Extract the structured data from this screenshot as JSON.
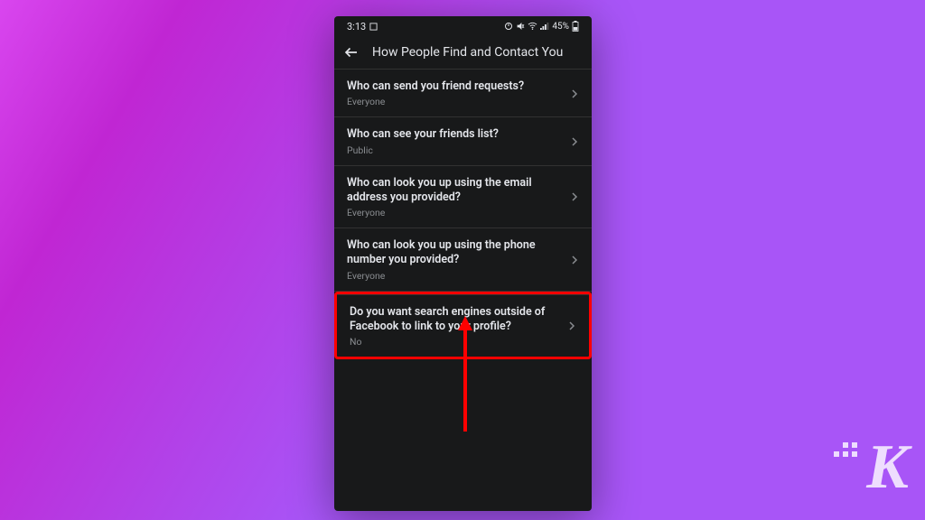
{
  "status_bar": {
    "time": "3:13",
    "battery": "45%"
  },
  "header": {
    "title": "How People Find and Contact You"
  },
  "settings": [
    {
      "label": "Who can send you friend requests?",
      "value": "Everyone"
    },
    {
      "label": "Who can see your friends list?",
      "value": "Public"
    },
    {
      "label": "Who can look you up using the email address you provided?",
      "value": "Everyone"
    },
    {
      "label": "Who can look you up using the phone number you provided?",
      "value": "Everyone"
    },
    {
      "label": "Do you want search engines outside of Facebook to link to your profile?",
      "value": "No"
    }
  ],
  "highlight_index": 4,
  "watermark": "K"
}
